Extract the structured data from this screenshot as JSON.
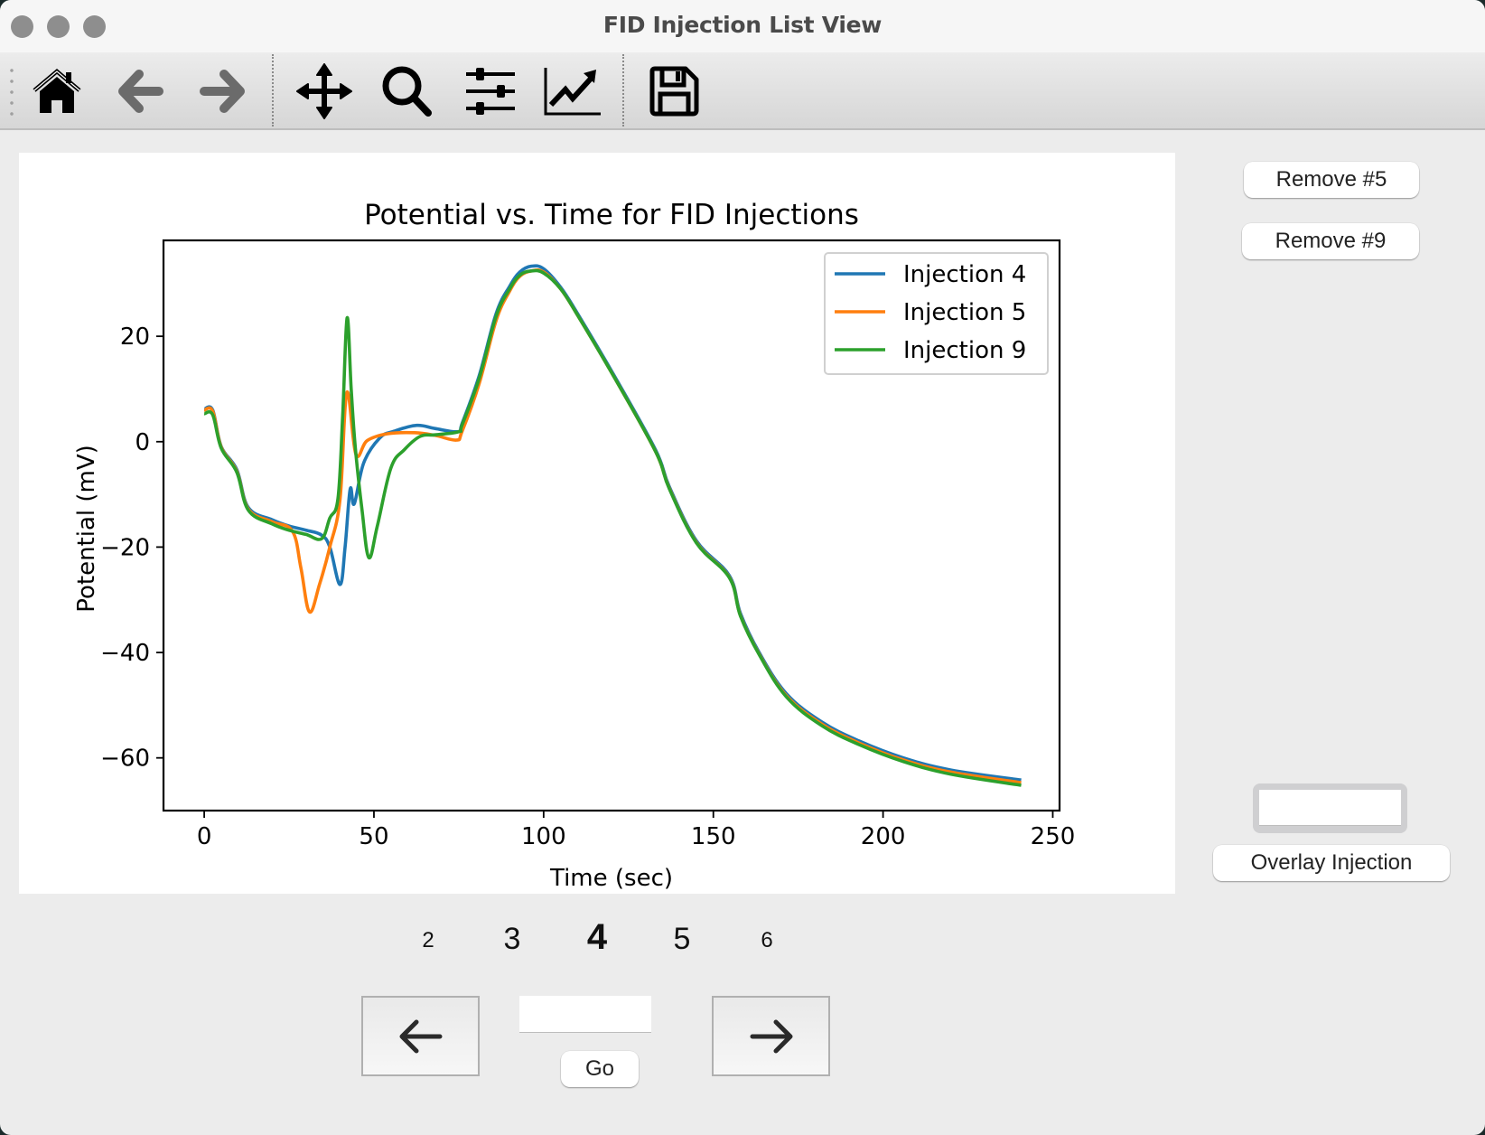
{
  "window": {
    "title": "FID Injection List View",
    "traffic_lights": [
      "close",
      "minimize",
      "zoom"
    ]
  },
  "toolbar": {
    "items": [
      {
        "name": "home",
        "icon": "home-icon",
        "enabled": true
      },
      {
        "name": "back",
        "icon": "arrow-left-icon",
        "enabled": false
      },
      {
        "name": "forward",
        "icon": "arrow-right-icon",
        "enabled": false
      },
      {
        "name": "pan",
        "icon": "move-icon",
        "enabled": true
      },
      {
        "name": "zoom",
        "icon": "magnifier-icon",
        "enabled": true
      },
      {
        "name": "configure-subplots",
        "icon": "sliders-icon",
        "enabled": true
      },
      {
        "name": "edit-axis",
        "icon": "line-chart-icon",
        "enabled": true
      },
      {
        "name": "save",
        "icon": "floppy-disk-icon",
        "enabled": true
      }
    ]
  },
  "side_panel": {
    "remove_buttons": [
      "Remove #5",
      "Remove #9"
    ],
    "overlay_input_value": "",
    "overlay_button_label": "Overlay Injection"
  },
  "pagination": {
    "pages": [
      "2",
      "3",
      "4",
      "5",
      "6"
    ],
    "current_page": "4",
    "prev_icon": "arrow-left-icon",
    "next_icon": "arrow-right-icon",
    "page_input_value": "",
    "go_label": "Go"
  },
  "colors": {
    "injection_4": "#1f77b4",
    "injection_5": "#ff7f0e",
    "injection_9": "#2ca02c"
  },
  "chart_data": {
    "type": "line",
    "title": "Potential vs. Time for FID Injections",
    "xlabel": "Time (sec)",
    "ylabel": "Potential (mV)",
    "xlim": [
      -12,
      252
    ],
    "ylim": [
      -70,
      38.2
    ],
    "xticks": [
      0,
      50,
      100,
      150,
      200,
      250
    ],
    "xtick_labels": [
      "0",
      "50",
      "100",
      "150",
      "200",
      "250"
    ],
    "yticks": [
      20,
      0,
      -20,
      -40,
      -60
    ],
    "ytick_labels": [
      "20",
      "0",
      "−20",
      "−40",
      "−60"
    ],
    "grid": false,
    "legend_position": "upper-right",
    "series": [
      {
        "name": "Injection 4",
        "color": "#1f77b4",
        "x": [
          0,
          2.5,
          5,
          9.6,
          13,
          20,
          25,
          30,
          34.5,
          37,
          40,
          41.5,
          43,
          44.2,
          47,
          51.7,
          56,
          62.6,
          68,
          74.8,
          76,
          81,
          86,
          90,
          93,
          96.4,
          100,
          105,
          110,
          121,
          133,
          137,
          145,
          154.7,
          158,
          163.5,
          171.5,
          182,
          193,
          206,
          220,
          240.7
        ],
        "y": [
          6.2,
          6.0,
          -0.9,
          -5.3,
          -12.5,
          -14.8,
          -16.0,
          -16.8,
          -17.7,
          -20,
          -27.1,
          -20,
          -9,
          -11.8,
          -4,
          0.7,
          2.0,
          3.1,
          2.5,
          1.9,
          3.5,
          12.5,
          24.3,
          29.5,
          32.2,
          33.3,
          32.8,
          29.3,
          24.3,
          12.3,
          -1.6,
          -8.5,
          -18.8,
          -25.4,
          -32.6,
          -40,
          -47.8,
          -53.2,
          -56.8,
          -60.0,
          -62.3,
          -64.2
        ]
      },
      {
        "name": "Injection 5",
        "color": "#ff7f0e",
        "x": [
          0,
          2.5,
          5,
          9.6,
          13,
          20,
          26,
          28.5,
          31,
          34,
          37,
          40,
          42,
          44.7,
          48,
          54,
          62,
          68,
          74.3,
          76,
          81,
          86,
          90,
          93,
          96.4,
          100,
          105,
          110,
          121,
          133,
          137,
          145,
          154.7,
          158,
          163.5,
          171.5,
          182,
          193,
          206,
          220,
          240.7
        ],
        "y": [
          6.0,
          5.8,
          -1.0,
          -5.6,
          -12.8,
          -15.2,
          -17.0,
          -24,
          -32.3,
          -27,
          -20,
          -11,
          9.3,
          -2.4,
          0.2,
          1.5,
          1.7,
          1.2,
          0.3,
          2.0,
          11.0,
          23.0,
          28.6,
          31.4,
          32.4,
          32.2,
          29.0,
          24.0,
          12.0,
          -1.9,
          -8.8,
          -19.1,
          -25.7,
          -33.0,
          -40.3,
          -48.2,
          -53.6,
          -57.2,
          -60.4,
          -62.7,
          -64.7
        ]
      },
      {
        "name": "Injection 9",
        "color": "#2ca02c",
        "x": [
          0,
          2.5,
          5,
          9.6,
          13,
          20,
          25,
          30,
          34.6,
          37,
          39.4,
          40.8,
          42.1,
          43.3,
          44.5,
          46.5,
          48.5,
          51,
          55,
          59,
          63.6,
          68,
          75,
          76,
          81,
          86,
          90,
          93,
          96.4,
          100,
          105,
          110,
          121,
          133,
          137,
          145,
          154.7,
          158,
          163.5,
          171.5,
          182,
          193,
          206,
          220,
          240.7
        ],
        "y": [
          5.3,
          5.1,
          -1.2,
          -5.8,
          -13.0,
          -15.6,
          -16.8,
          -17.6,
          -18.4,
          -14.5,
          -10.8,
          5,
          23.5,
          10,
          -1,
          -13,
          -22,
          -16,
          -5,
          -1.5,
          1.0,
          1.3,
          1.9,
          3.2,
          12.0,
          23.8,
          29.0,
          31.6,
          32.4,
          32.0,
          29.0,
          24.0,
          12.0,
          -1.9,
          -8.9,
          -19.2,
          -25.8,
          -33.1,
          -40.4,
          -48.4,
          -53.9,
          -57.5,
          -60.7,
          -63.1,
          -65.2
        ]
      }
    ]
  }
}
